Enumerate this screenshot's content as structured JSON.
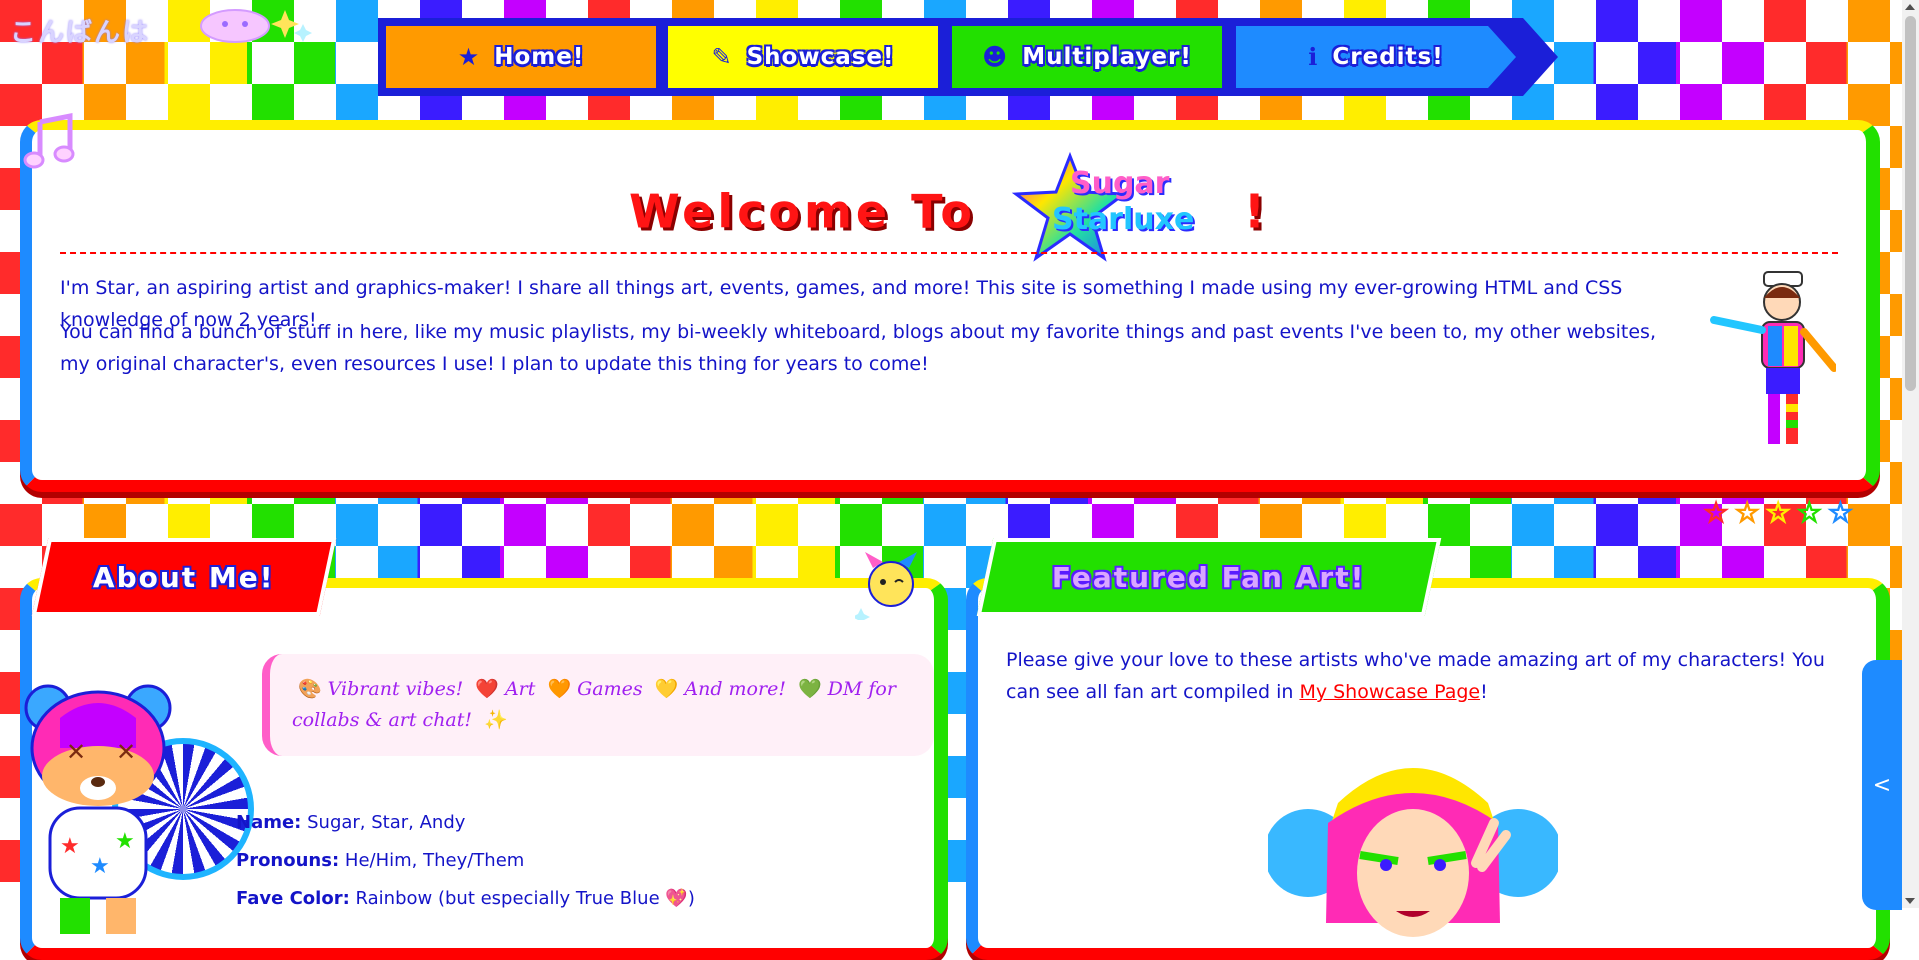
{
  "greeting": "こんばんは",
  "nav": {
    "items": [
      {
        "label": "Home!",
        "icon": "star-icon"
      },
      {
        "label": "Showcase!",
        "icon": "pencil-icon"
      },
      {
        "label": "Multiplayer!",
        "icon": "users-icon"
      },
      {
        "label": "Credits!",
        "icon": "info-icon"
      }
    ]
  },
  "welcome": {
    "title_prefix": "Welcome To",
    "logo_line1": "Sugar",
    "logo_line2": "Starluxe",
    "title_suffix": "!",
    "paragraph1": "I'm Star, an aspiring artist and graphics-maker! I share all things art, events, games, and more! This site is something I made using my ever-growing HTML and CSS knowledge of now 2 years!",
    "paragraph2": "You can find a bunch of stuff in here, like my music playlists, my bi-weekly whiteboard, blogs about my favorite things and past events I've been to, my other websites, my original character's, even resources I use! I plan to update this thing for years to come!"
  },
  "about": {
    "tab_label": "About Me!",
    "bubble": {
      "parts": [
        "Vibrant vibes!",
        "Art",
        "Games",
        "And more!",
        "DM for collabs & art chat!"
      ],
      "emojis": [
        "🎨",
        "❤️",
        "🧡",
        "💛",
        "💚",
        "✨"
      ]
    },
    "name_label": "Name:",
    "name_value": "Sugar, Star, Andy",
    "pronouns_label": "Pronouns:",
    "pronouns_value": "He/Him, They/Them",
    "color_label": "Fave Color:",
    "color_value": "Rainbow (but especially True Blue",
    "color_emoji": "💖",
    "color_close": ")"
  },
  "fanart": {
    "tab_label": "Featured Fan Art!",
    "text": "Please give your love to these artists who've made amazing art of my characters! You can see all fan art compiled in ",
    "link_text": "My Showcase Page",
    "text_end": "!"
  },
  "side_tab": "<",
  "colors": {
    "red": "#ff0000",
    "orange": "#ff9a00",
    "yellow": "#ffff00",
    "green": "#22e000",
    "blue": "#1e8bff",
    "navy": "#1b1fd8",
    "purple": "#c400ff",
    "text_blue": "#1414c8"
  }
}
